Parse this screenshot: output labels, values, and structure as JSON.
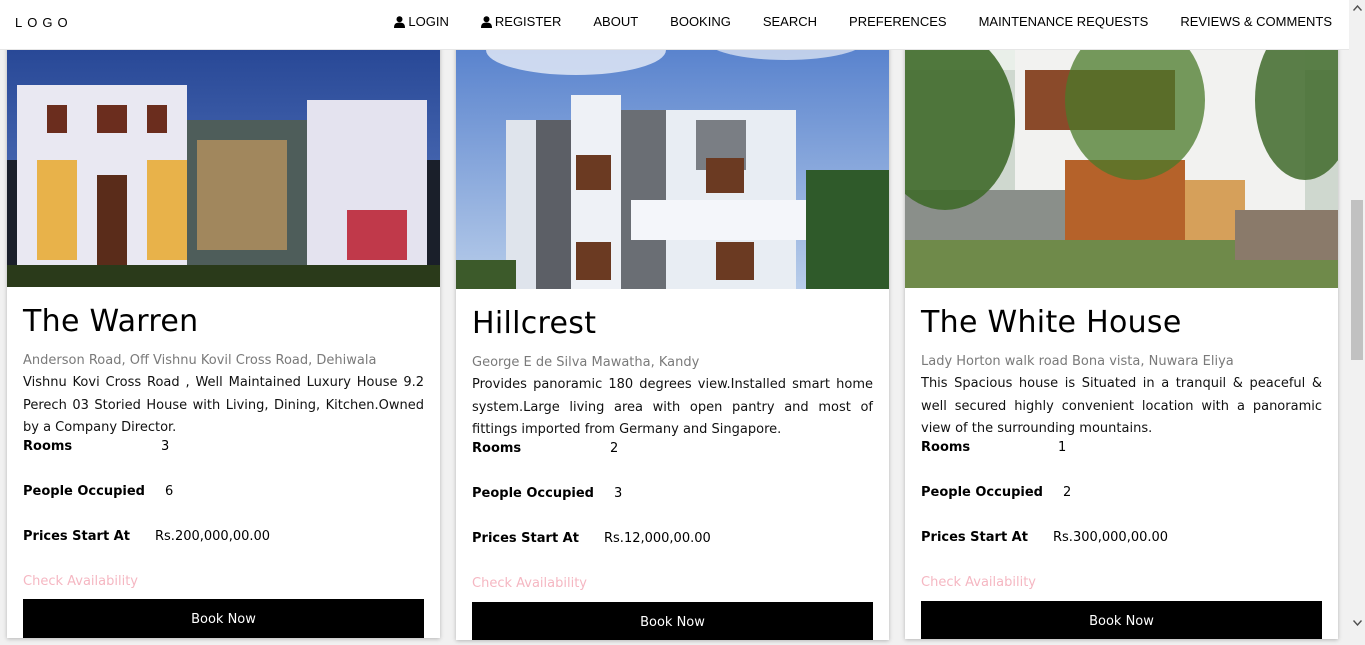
{
  "navbar": {
    "logo": "LOGO",
    "items": [
      {
        "label": "LOGIN",
        "icon": "user-icon"
      },
      {
        "label": "REGISTER",
        "icon": "user-icon"
      },
      {
        "label": "ABOUT"
      },
      {
        "label": "BOOKING"
      },
      {
        "label": "SEARCH"
      },
      {
        "label": "PREFERENCES"
      },
      {
        "label": "MAINTENANCE REQUESTS"
      },
      {
        "label": "REVIEWS & COMMENTS"
      }
    ]
  },
  "labels": {
    "rooms": "Rooms",
    "people": "People Occupied",
    "price": "Prices Start At",
    "check": "Check Availability",
    "book": "Book Now"
  },
  "properties": [
    {
      "name": "The Warren",
      "address": "Anderson Road, Off Vishnu Kovil Cross Road, Dehiwala",
      "description": "Vishnu Kovi Cross Road , Well Maintained Luxury House 9.2 Perech 03 Storied House with Living, Dining, Kitchen.Owned by a Company Director.",
      "rooms": "3",
      "people": "6",
      "price": "Rs.200,000,00.00"
    },
    {
      "name": "Hillcrest",
      "address": "George E de Silva Mawatha, Kandy",
      "description": "Provides panoramic 180 degrees view.Installed smart home system.Large living area with open pantry and most of fittings imported from Germany and Singapore.",
      "rooms": "2",
      "people": "3",
      "price": "Rs.12,000,00.00"
    },
    {
      "name": "The White House",
      "address": "Lady Horton walk road Bona vista, Nuwara Eliya",
      "description": "This Spacious house is Situated in a tranquil & peaceful & well secured highly convenient location with a panoramic view of the surrounding mountains.",
      "rooms": "1",
      "people": "2",
      "price": "Rs.300,000,00.00"
    }
  ],
  "colors": {
    "check_link": "#f5b7c2",
    "button": "#000000"
  }
}
